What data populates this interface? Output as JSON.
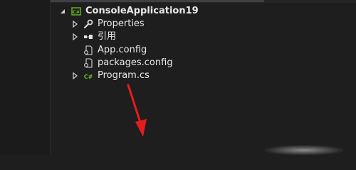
{
  "solution_explorer": {
    "project": {
      "label": "ConsoleApplication19",
      "icon": "csharp-project-icon",
      "expanded": true
    },
    "items": [
      {
        "label": "Properties",
        "icon": "wrench-icon",
        "expandable": true
      },
      {
        "label": "引用",
        "icon": "references-icon",
        "expandable": true
      },
      {
        "label": "App.config",
        "icon": "config-file-icon",
        "expandable": false
      },
      {
        "label": "packages.config",
        "icon": "config-file-icon",
        "expandable": false
      },
      {
        "label": "Program.cs",
        "icon": "csharp-file-icon",
        "expandable": true
      }
    ]
  },
  "annotation": {
    "type": "red-arrow",
    "color": "#e51c1c",
    "direction": "up"
  },
  "colors": {
    "background": "#1e1e1e",
    "text": "#e8e8e8",
    "csharp_green": "#68b723",
    "arrow": "#e51c1c"
  }
}
